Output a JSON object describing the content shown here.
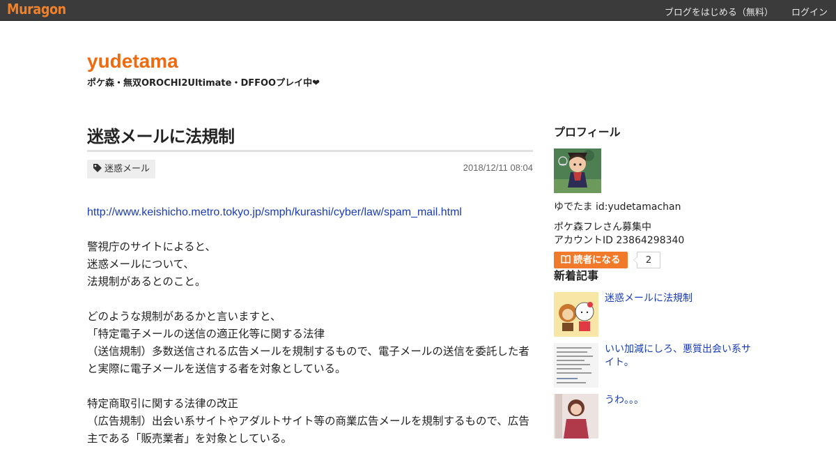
{
  "topbar": {
    "logo": "Muragon",
    "links": [
      "ブログをはじめる（無料）",
      "ログイン"
    ]
  },
  "blog": {
    "title": "yudetama",
    "subtitle": "ポケ森・無双OROCHI2Ultimate・DFFOOプレイ中❤"
  },
  "post": {
    "title": "迷惑メールに法規制",
    "tag": "迷惑メール",
    "date": "2018/12/11 08:04",
    "link": "http://www.keishicho.metro.tokyo.jp/smph/kurashi/cyber/law/spam_mail.html",
    "paragraphs": [
      [
        "警視庁のサイトによると、",
        "迷惑メールについて、",
        "法規制があるとのこと。"
      ],
      [
        "どのような規制があるかと言いますと、",
        "「特定電子メールの送信の適正化等に関する法律",
        "（送信規制）多数送信される広告メールを規制するもので、電子メールの送信を委託した者と実際に電子メールを送信する者を対象としている。"
      ],
      [
        "特定商取引に関する法律の改正",
        "（広告規制）出会い系サイトやアダルトサイト等の商業広告メールを規制するもので、広告主である「販売業者」を対象としている。"
      ]
    ]
  },
  "sidebar": {
    "profile_heading": "プロフィール",
    "profile_name": "ゆでたま  id:yudetamachan",
    "profile_desc": [
      "ポケ森フレさん募集中",
      "アカウントID 23864298340"
    ],
    "follow_label": "読者になる",
    "follow_count": "2",
    "recent_heading": "新着記事",
    "recent": [
      {
        "title": "迷惑メールに法規制"
      },
      {
        "title": "いい加減にしろ、悪質出会い系サイト。"
      },
      {
        "title": "うわ。。。"
      }
    ]
  },
  "colors": {
    "accent": "#f06a0f",
    "topbar": "#3b3b3b",
    "link": "#1a3bb8",
    "follow_button": "#f07a2a"
  },
  "icons": [
    "tag-icon",
    "book-icon"
  ]
}
